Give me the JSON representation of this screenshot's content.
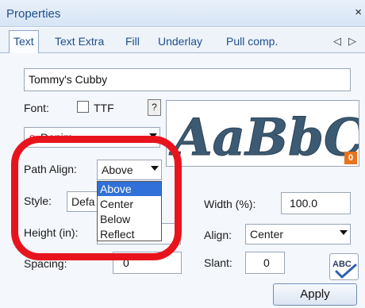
{
  "window": {
    "title": "Properties",
    "close_glyph": "×"
  },
  "tabs": [
    {
      "label": "Text",
      "active": true
    },
    {
      "label": "Text Extra"
    },
    {
      "label": "Fill"
    },
    {
      "label": "Underlay"
    },
    {
      "label": "Pull comp."
    }
  ],
  "tab_scroll": {
    "left": "◁",
    "right": "▷"
  },
  "text_input": {
    "value": "Tommy's Cubby"
  },
  "font": {
    "label": "Font:",
    "ttf_label": "TTF",
    "ttf_checked": false,
    "help_label": "?",
    "selected": "Denim",
    "font_icon": "red-o-glyph"
  },
  "preview": {
    "text": "AaBbCc",
    "color": "#3d5a73",
    "badge": "0"
  },
  "path_align": {
    "label": "Path Align:",
    "value": "Above",
    "options": [
      "Above",
      "Center",
      "Below",
      "Reflect"
    ],
    "highlighted": "Above"
  },
  "style": {
    "label": "Style:",
    "value": "Defa"
  },
  "height": {
    "label": "Height (in):"
  },
  "spacing": {
    "label": "Spacing:",
    "value": "0"
  },
  "width": {
    "label": "Width (%):",
    "value": "100.0"
  },
  "align": {
    "label": "Align:",
    "value": "Center"
  },
  "slant": {
    "label": "Slant:",
    "value": "0"
  },
  "spell_check": {
    "label": "ABC",
    "icon": "spell-check-icon"
  },
  "apply_button": {
    "label": "Apply"
  },
  "colors": {
    "highlight_ring": "#e8141d",
    "selection": "#3170d8",
    "title_text": "#1e4e8c",
    "badge": "#e8731d"
  }
}
